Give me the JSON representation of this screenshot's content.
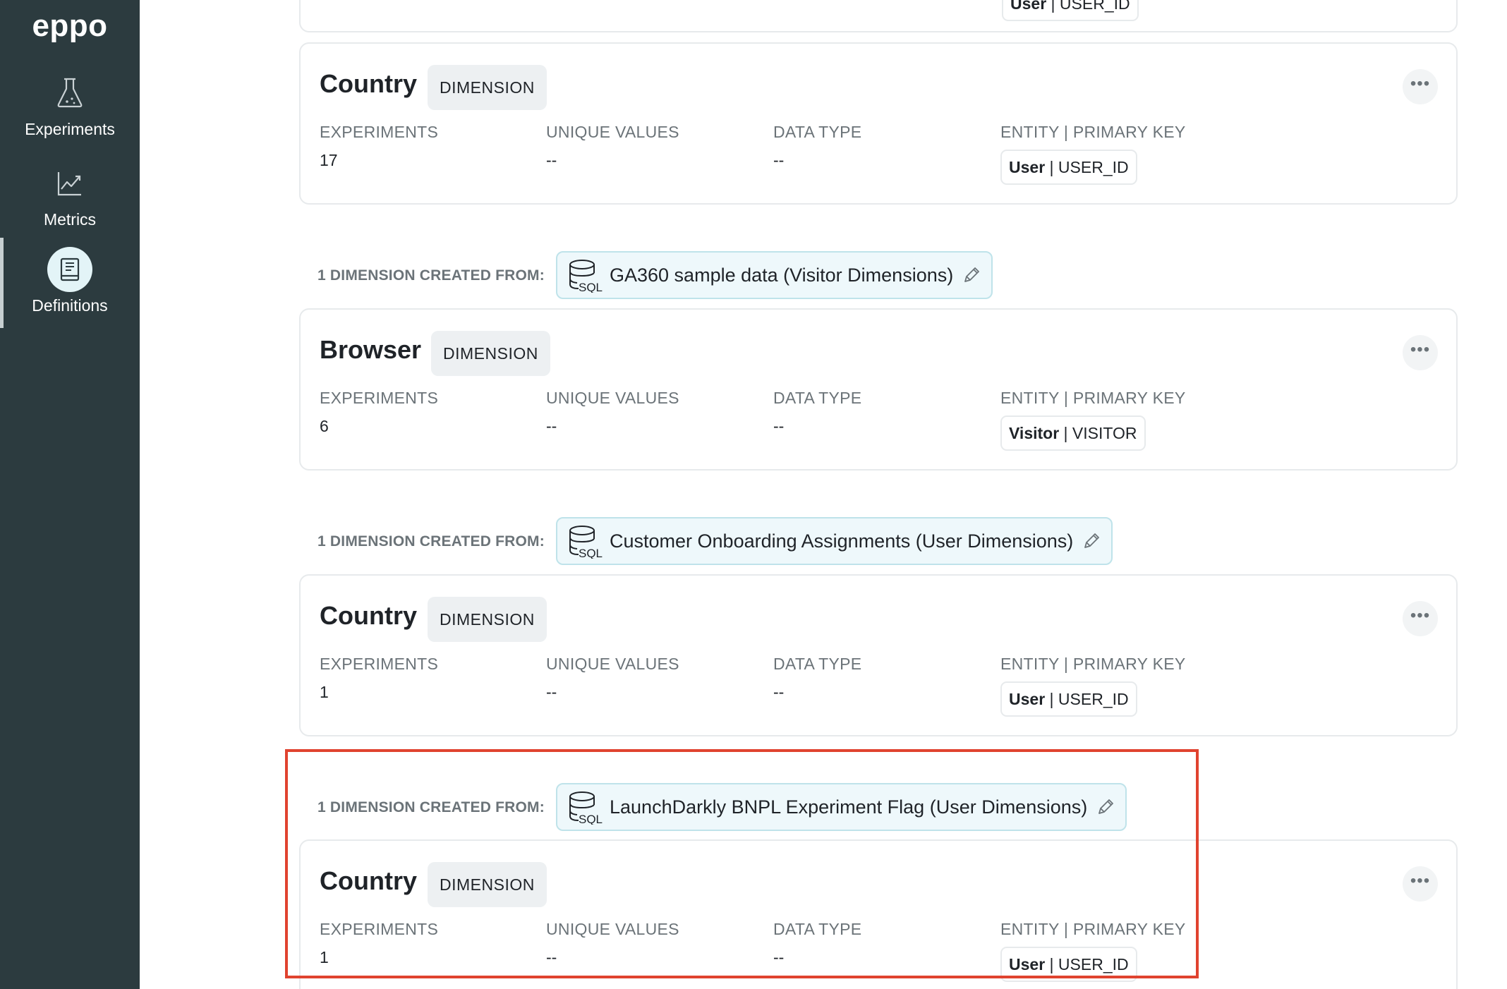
{
  "sidebar": {
    "logo": "eppo",
    "items": [
      {
        "label": "Experiments",
        "icon": "flask-icon"
      },
      {
        "label": "Metrics",
        "icon": "chart-line-icon"
      },
      {
        "label": "Definitions",
        "icon": "book-icon",
        "active": true
      }
    ]
  },
  "field_labels": {
    "experiments": "EXPERIMENTS",
    "unique_values": "UNIQUE VALUES",
    "data_type": "DATA TYPE",
    "entity_primary_key": "ENTITY | PRIMARY KEY"
  },
  "top_partial_card": {
    "entity": "User",
    "primary_key": "| USER_ID"
  },
  "cards": [
    {
      "title": "Country",
      "badge": "DIMENSION",
      "experiments": "17",
      "unique_values": "--",
      "data_type": "--",
      "entity": "User",
      "primary_key": "| USER_ID"
    },
    {
      "title": "Browser",
      "badge": "DIMENSION",
      "experiments": "6",
      "unique_values": "--",
      "data_type": "--",
      "entity": "Visitor",
      "primary_key": "| VISITOR"
    },
    {
      "title": "Country",
      "badge": "DIMENSION",
      "experiments": "1",
      "unique_values": "--",
      "data_type": "--",
      "entity": "User",
      "primary_key": "| USER_ID"
    },
    {
      "title": "Country",
      "badge": "DIMENSION",
      "experiments": "1",
      "unique_values": "--",
      "data_type": "--",
      "entity": "User",
      "primary_key": "| USER_ID"
    }
  ],
  "sections": [
    {
      "label": "1 DIMENSION CREATED FROM:",
      "source": "GA360 sample data (Visitor Dimensions)"
    },
    {
      "label": "1 DIMENSION CREATED FROM:",
      "source": "Customer Onboarding Assignments (User Dimensions)"
    },
    {
      "label": "1 DIMENSION CREATED FROM:",
      "source": "LaunchDarkly BNPL Experiment Flag (User Dimensions)"
    }
  ],
  "more_button": "•••",
  "colors": {
    "sidebar_bg": "#2c3b3f",
    "highlight": "#e0432f",
    "chip_bg": "#eef8fb",
    "chip_border": "#bfe3ea"
  }
}
